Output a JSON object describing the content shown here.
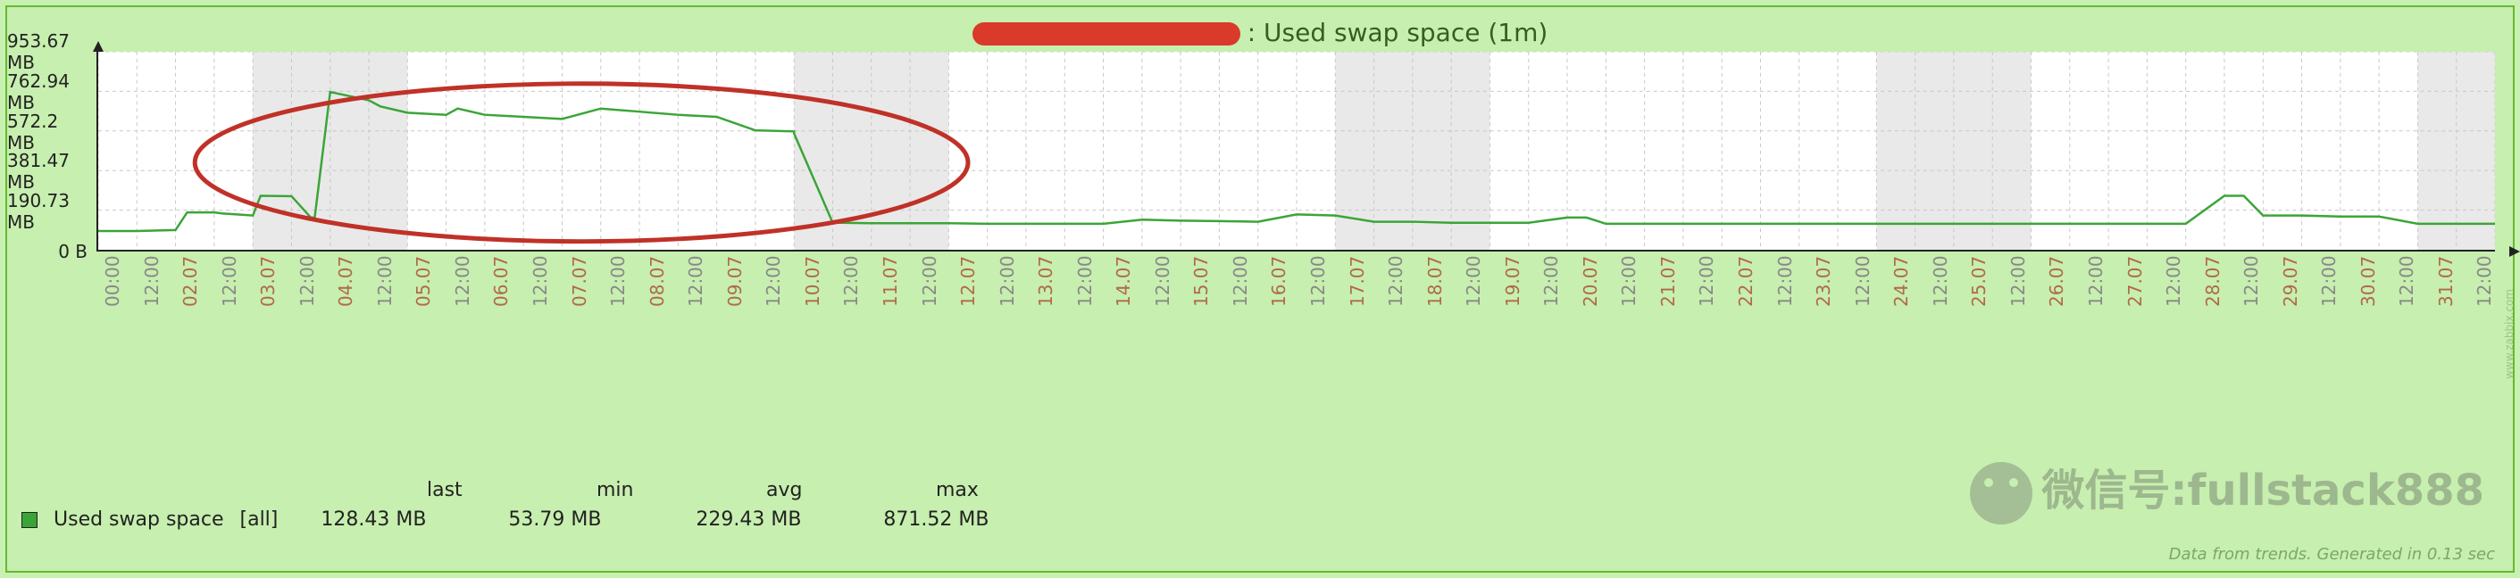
{
  "title_suffix": ": Used swap space  (1m)",
  "chart_data": {
    "type": "line",
    "ylabel": "",
    "ylim": [
      0,
      953.67
    ],
    "yticks": [
      {
        "v": 0,
        "label": "0 B"
      },
      {
        "v": 190.73,
        "label": "190.73 MB"
      },
      {
        "v": 381.47,
        "label": "381.47 MB"
      },
      {
        "v": 572.2,
        "label": "572.2 MB"
      },
      {
        "v": 762.94,
        "label": "762.94 MB"
      },
      {
        "v": 953.67,
        "label": "953.67 MB"
      }
    ],
    "x_categories": [
      "00:00",
      "12:00",
      "02.07",
      "12:00",
      "03.07",
      "12:00",
      "04.07",
      "12:00",
      "05.07",
      "12:00",
      "06.07",
      "12:00",
      "07.07",
      "12:00",
      "08.07",
      "12:00",
      "09.07",
      "12:00",
      "10.07",
      "12:00",
      "11.07",
      "12:00",
      "12.07",
      "12:00",
      "13.07",
      "12:00",
      "14.07",
      "12:00",
      "15.07",
      "12:00",
      "16.07",
      "12:00",
      "17.07",
      "12:00",
      "18.07",
      "12:00",
      "19.07",
      "12:00",
      "20.07",
      "12:00",
      "21.07",
      "12:00",
      "22.07",
      "12:00",
      "23.07",
      "12:00",
      "24.07",
      "12:00",
      "25.07",
      "12:00",
      "26.07",
      "12:00",
      "27.07",
      "12:00",
      "28.07",
      "12:00",
      "29.07",
      "12:00",
      "30.07",
      "12:00",
      "31.07",
      "12:00"
    ],
    "x_is_date": [
      false,
      false,
      true,
      false,
      true,
      false,
      true,
      false,
      true,
      false,
      true,
      false,
      true,
      false,
      true,
      false,
      true,
      false,
      true,
      false,
      true,
      false,
      true,
      false,
      true,
      false,
      true,
      false,
      true,
      false,
      true,
      false,
      true,
      false,
      true,
      false,
      true,
      false,
      true,
      false,
      true,
      false,
      true,
      false,
      true,
      false,
      true,
      false,
      true,
      false,
      true,
      false,
      true,
      false,
      true,
      false,
      true,
      false,
      true,
      false,
      true,
      false
    ],
    "weekend_bands": [
      [
        4,
        8
      ],
      [
        18,
        22
      ],
      [
        32,
        36
      ],
      [
        46,
        50
      ],
      [
        60,
        62
      ]
    ],
    "series": [
      {
        "name": "Used swap space",
        "values_x": [
          0,
          1,
          2,
          2.3,
          3,
          3.2,
          4,
          4.2,
          5,
          5.5,
          5.6,
          6,
          7,
          7.3,
          8,
          9,
          9.3,
          10,
          11,
          12,
          13,
          14,
          15,
          16,
          17,
          18,
          18,
          19,
          19.2,
          20,
          20.2,
          21,
          22,
          23,
          24,
          25,
          26,
          27,
          28,
          29,
          30,
          31,
          32,
          33,
          34,
          35,
          36,
          37,
          38,
          38.5,
          39,
          40,
          41,
          42,
          43,
          44,
          45,
          46,
          47,
          48,
          49,
          50,
          51,
          52,
          53,
          54,
          55,
          55.5,
          56,
          56.5,
          57,
          58,
          59,
          60,
          61,
          62
        ],
        "values_y": [
          90,
          90,
          95,
          180,
          180,
          175,
          165,
          260,
          258,
          155,
          155,
          760,
          720,
          690,
          660,
          650,
          680,
          650,
          640,
          630,
          680,
          665,
          650,
          640,
          575,
          570,
          560,
          130,
          130,
          128,
          128,
          128,
          128,
          125,
          125,
          125,
          125,
          145,
          140,
          138,
          135,
          170,
          165,
          135,
          135,
          130,
          130,
          130,
          155,
          155,
          125,
          125,
          125,
          125,
          125,
          125,
          125,
          125,
          125,
          125,
          125,
          125,
          125,
          125,
          125,
          125,
          260,
          260,
          165,
          165,
          165,
          160,
          160,
          125,
          125,
          125
        ]
      }
    ],
    "ellipse": {
      "cx": 12.5,
      "cy": 420,
      "rx": 10,
      "ry": 380
    }
  },
  "legend": {
    "name": "Used swap space",
    "scope": "[all]",
    "stats": [
      {
        "label": "last",
        "value": "128.43 MB"
      },
      {
        "label": "min",
        "value": "53.79 MB"
      },
      {
        "label": "avg",
        "value": "229.43 MB"
      },
      {
        "label": "max",
        "value": "871.52 MB"
      }
    ]
  },
  "footer": "Data from trends. Generated in 0.13 sec",
  "side_credit": "www.zabbix.com",
  "watermark": "微信号:fullstack888"
}
